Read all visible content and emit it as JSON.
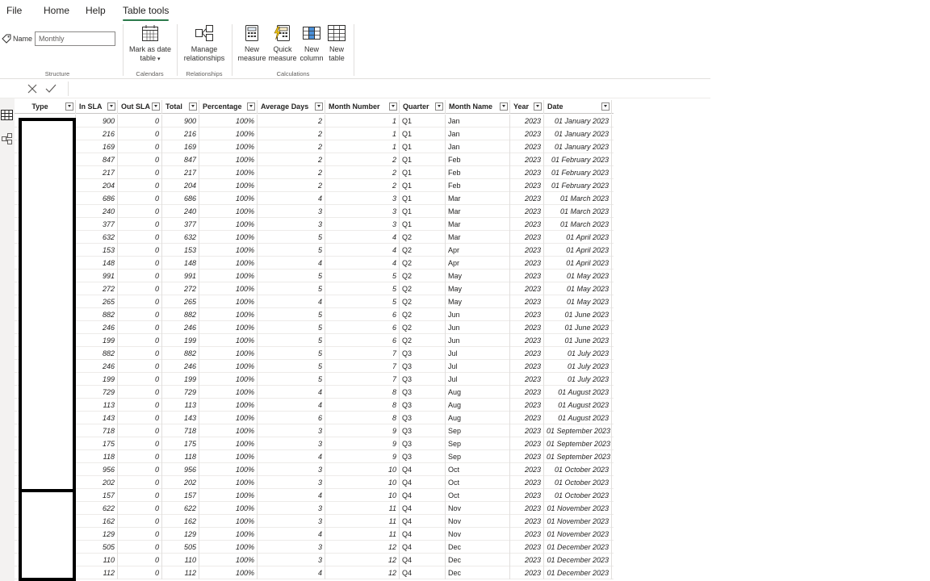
{
  "menu": {
    "file": "File",
    "home": "Home",
    "help": "Help",
    "table_tools": "Table tools"
  },
  "ribbon": {
    "name_label": "Name",
    "name_value": "Monthly",
    "structure_label": "Structure",
    "mark_as_date": "Mark as date",
    "mark_as_date_line2": "table",
    "calendars_label": "Calendars",
    "manage": "Manage",
    "manage_line2": "relationships",
    "relationships_label": "Relationships",
    "new_measure": "New",
    "new_measure_line2": "measure",
    "quick_measure": "Quick",
    "quick_measure_line2": "measure",
    "new_column": "New",
    "new_column_line2": "column",
    "new_table": "New",
    "new_table_line2": "table",
    "calculations_label": "Calculations"
  },
  "table": {
    "columns": [
      "Type",
      "In SLA",
      "Out SLA",
      "Total",
      "Percentage",
      "Average Days",
      "Month Number",
      "Quarter",
      "Month Name",
      "Year",
      "Date"
    ],
    "rows": [
      [
        "",
        "900",
        "0",
        "900",
        "100%",
        "2",
        "1",
        "Q1",
        "Jan",
        "2023",
        "01 January 2023"
      ],
      [
        "",
        "216",
        "0",
        "216",
        "100%",
        "2",
        "1",
        "Q1",
        "Jan",
        "2023",
        "01 January 2023"
      ],
      [
        "",
        "169",
        "0",
        "169",
        "100%",
        "2",
        "1",
        "Q1",
        "Jan",
        "2023",
        "01 January 2023"
      ],
      [
        "",
        "847",
        "0",
        "847",
        "100%",
        "2",
        "2",
        "Q1",
        "Feb",
        "2023",
        "01 February 2023"
      ],
      [
        "",
        "217",
        "0",
        "217",
        "100%",
        "2",
        "2",
        "Q1",
        "Feb",
        "2023",
        "01 February 2023"
      ],
      [
        "",
        "204",
        "0",
        "204",
        "100%",
        "2",
        "2",
        "Q1",
        "Feb",
        "2023",
        "01 February 2023"
      ],
      [
        "",
        "686",
        "0",
        "686",
        "100%",
        "4",
        "3",
        "Q1",
        "Mar",
        "2023",
        "01 March 2023"
      ],
      [
        "",
        "240",
        "0",
        "240",
        "100%",
        "3",
        "3",
        "Q1",
        "Mar",
        "2023",
        "01 March 2023"
      ],
      [
        "",
        "377",
        "0",
        "377",
        "100%",
        "3",
        "3",
        "Q1",
        "Mar",
        "2023",
        "01 March 2023"
      ],
      [
        "",
        "632",
        "0",
        "632",
        "100%",
        "5",
        "4",
        "Q2",
        "Mar",
        "2023",
        "01 April 2023"
      ],
      [
        "",
        "153",
        "0",
        "153",
        "100%",
        "5",
        "4",
        "Q2",
        "Apr",
        "2023",
        "01 April 2023"
      ],
      [
        "",
        "148",
        "0",
        "148",
        "100%",
        "4",
        "4",
        "Q2",
        "Apr",
        "2023",
        "01 April 2023"
      ],
      [
        "",
        "991",
        "0",
        "991",
        "100%",
        "5",
        "5",
        "Q2",
        "May",
        "2023",
        "01 May 2023"
      ],
      [
        "",
        "272",
        "0",
        "272",
        "100%",
        "5",
        "5",
        "Q2",
        "May",
        "2023",
        "01 May 2023"
      ],
      [
        "",
        "265",
        "0",
        "265",
        "100%",
        "4",
        "5",
        "Q2",
        "May",
        "2023",
        "01 May 2023"
      ],
      [
        "",
        "882",
        "0",
        "882",
        "100%",
        "5",
        "6",
        "Q2",
        "Jun",
        "2023",
        "01 June 2023"
      ],
      [
        "",
        "246",
        "0",
        "246",
        "100%",
        "5",
        "6",
        "Q2",
        "Jun",
        "2023",
        "01 June 2023"
      ],
      [
        "",
        "199",
        "0",
        "199",
        "100%",
        "5",
        "6",
        "Q2",
        "Jun",
        "2023",
        "01 June 2023"
      ],
      [
        "",
        "882",
        "0",
        "882",
        "100%",
        "5",
        "7",
        "Q3",
        "Jul",
        "2023",
        "01 July 2023"
      ],
      [
        "",
        "246",
        "0",
        "246",
        "100%",
        "5",
        "7",
        "Q3",
        "Jul",
        "2023",
        "01 July 2023"
      ],
      [
        "",
        "199",
        "0",
        "199",
        "100%",
        "5",
        "7",
        "Q3",
        "Jul",
        "2023",
        "01 July 2023"
      ],
      [
        "",
        "729",
        "0",
        "729",
        "100%",
        "4",
        "8",
        "Q3",
        "Aug",
        "2023",
        "01 August 2023"
      ],
      [
        "",
        "113",
        "0",
        "113",
        "100%",
        "4",
        "8",
        "Q3",
        "Aug",
        "2023",
        "01 August 2023"
      ],
      [
        "",
        "143",
        "0",
        "143",
        "100%",
        "6",
        "8",
        "Q3",
        "Aug",
        "2023",
        "01 August 2023"
      ],
      [
        "",
        "718",
        "0",
        "718",
        "100%",
        "3",
        "9",
        "Q3",
        "Sep",
        "2023",
        "01 September 2023"
      ],
      [
        "",
        "175",
        "0",
        "175",
        "100%",
        "3",
        "9",
        "Q3",
        "Sep",
        "2023",
        "01 September 2023"
      ],
      [
        "",
        "118",
        "0",
        "118",
        "100%",
        "4",
        "9",
        "Q3",
        "Sep",
        "2023",
        "01 September 2023"
      ],
      [
        "",
        "956",
        "0",
        "956",
        "100%",
        "3",
        "10",
        "Q4",
        "Oct",
        "2023",
        "01 October 2023"
      ],
      [
        "",
        "202",
        "0",
        "202",
        "100%",
        "3",
        "10",
        "Q4",
        "Oct",
        "2023",
        "01 October 2023"
      ],
      [
        "",
        "157",
        "0",
        "157",
        "100%",
        "4",
        "10",
        "Q4",
        "Oct",
        "2023",
        "01 October 2023"
      ],
      [
        "",
        "622",
        "0",
        "622",
        "100%",
        "3",
        "11",
        "Q4",
        "Nov",
        "2023",
        "01 November 2023"
      ],
      [
        "",
        "162",
        "0",
        "162",
        "100%",
        "3",
        "11",
        "Q4",
        "Nov",
        "2023",
        "01 November 2023"
      ],
      [
        "",
        "129",
        "0",
        "129",
        "100%",
        "4",
        "11",
        "Q4",
        "Nov",
        "2023",
        "01 November 2023"
      ],
      [
        "",
        "505",
        "0",
        "505",
        "100%",
        "3",
        "12",
        "Q4",
        "Dec",
        "2023",
        "01 December 2023"
      ],
      [
        "",
        "110",
        "0",
        "110",
        "100%",
        "3",
        "12",
        "Q4",
        "Dec",
        "2023",
        "01 December 2023"
      ],
      [
        "",
        "112",
        "0",
        "112",
        "100%",
        "4",
        "12",
        "Q4",
        "Dec",
        "2023",
        "01 December 2023"
      ]
    ]
  },
  "colors": {
    "accent": "#2b7a4b",
    "grid_line": "#e1dfdd",
    "redaction": "#000000"
  }
}
